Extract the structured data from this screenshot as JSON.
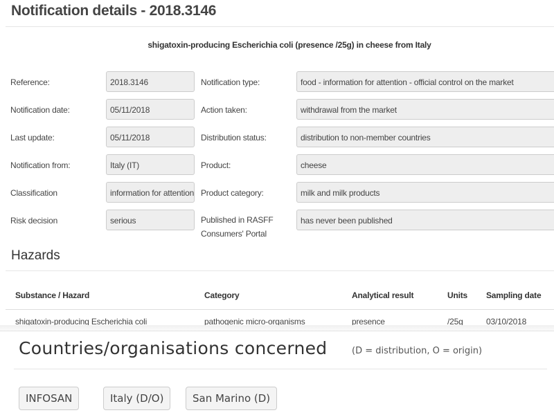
{
  "page": {
    "title": "Notification details - 2018.3146",
    "subject": "shigatoxin-producing Escherichia coli (presence /25g) in cheese from Italy"
  },
  "details": {
    "left": [
      {
        "label": "Reference:",
        "value": "2018.3146"
      },
      {
        "label": "Notification date:",
        "value": "05/11/2018"
      },
      {
        "label": "Last update:",
        "value": "05/11/2018"
      },
      {
        "label": "Notification from:",
        "value": "Italy (IT)"
      },
      {
        "label": "Classification",
        "value": "information for attention"
      },
      {
        "label": "Risk decision",
        "value": "serious"
      }
    ],
    "right": [
      {
        "label": "Notification type:",
        "value": "food - information for attention - official control on the market"
      },
      {
        "label": "Action taken:",
        "value": "withdrawal from the market"
      },
      {
        "label": "Distribution status:",
        "value": "distribution to non-member countries"
      },
      {
        "label": "Product:",
        "value": "cheese"
      },
      {
        "label": "Product category:",
        "value": "milk and milk products"
      },
      {
        "label": "Published in RASFF Consumers' Portal",
        "value": "has never been published"
      }
    ]
  },
  "hazards": {
    "title": "Hazards",
    "columns": [
      "Substance / Hazard",
      "Category",
      "Analytical result",
      "Units",
      "Sampling date"
    ],
    "rows": [
      [
        "shigatoxin-producing Escherichia coli",
        "pathogenic micro-organisms",
        "presence",
        "/25g",
        "03/10/2018"
      ]
    ]
  },
  "countries": {
    "title": "Countries/organisations concerned",
    "note": "(D = distribution, O = origin)",
    "buttons": [
      "INFOSAN",
      "Italy (D/O)",
      "San Marino (D)"
    ]
  }
}
